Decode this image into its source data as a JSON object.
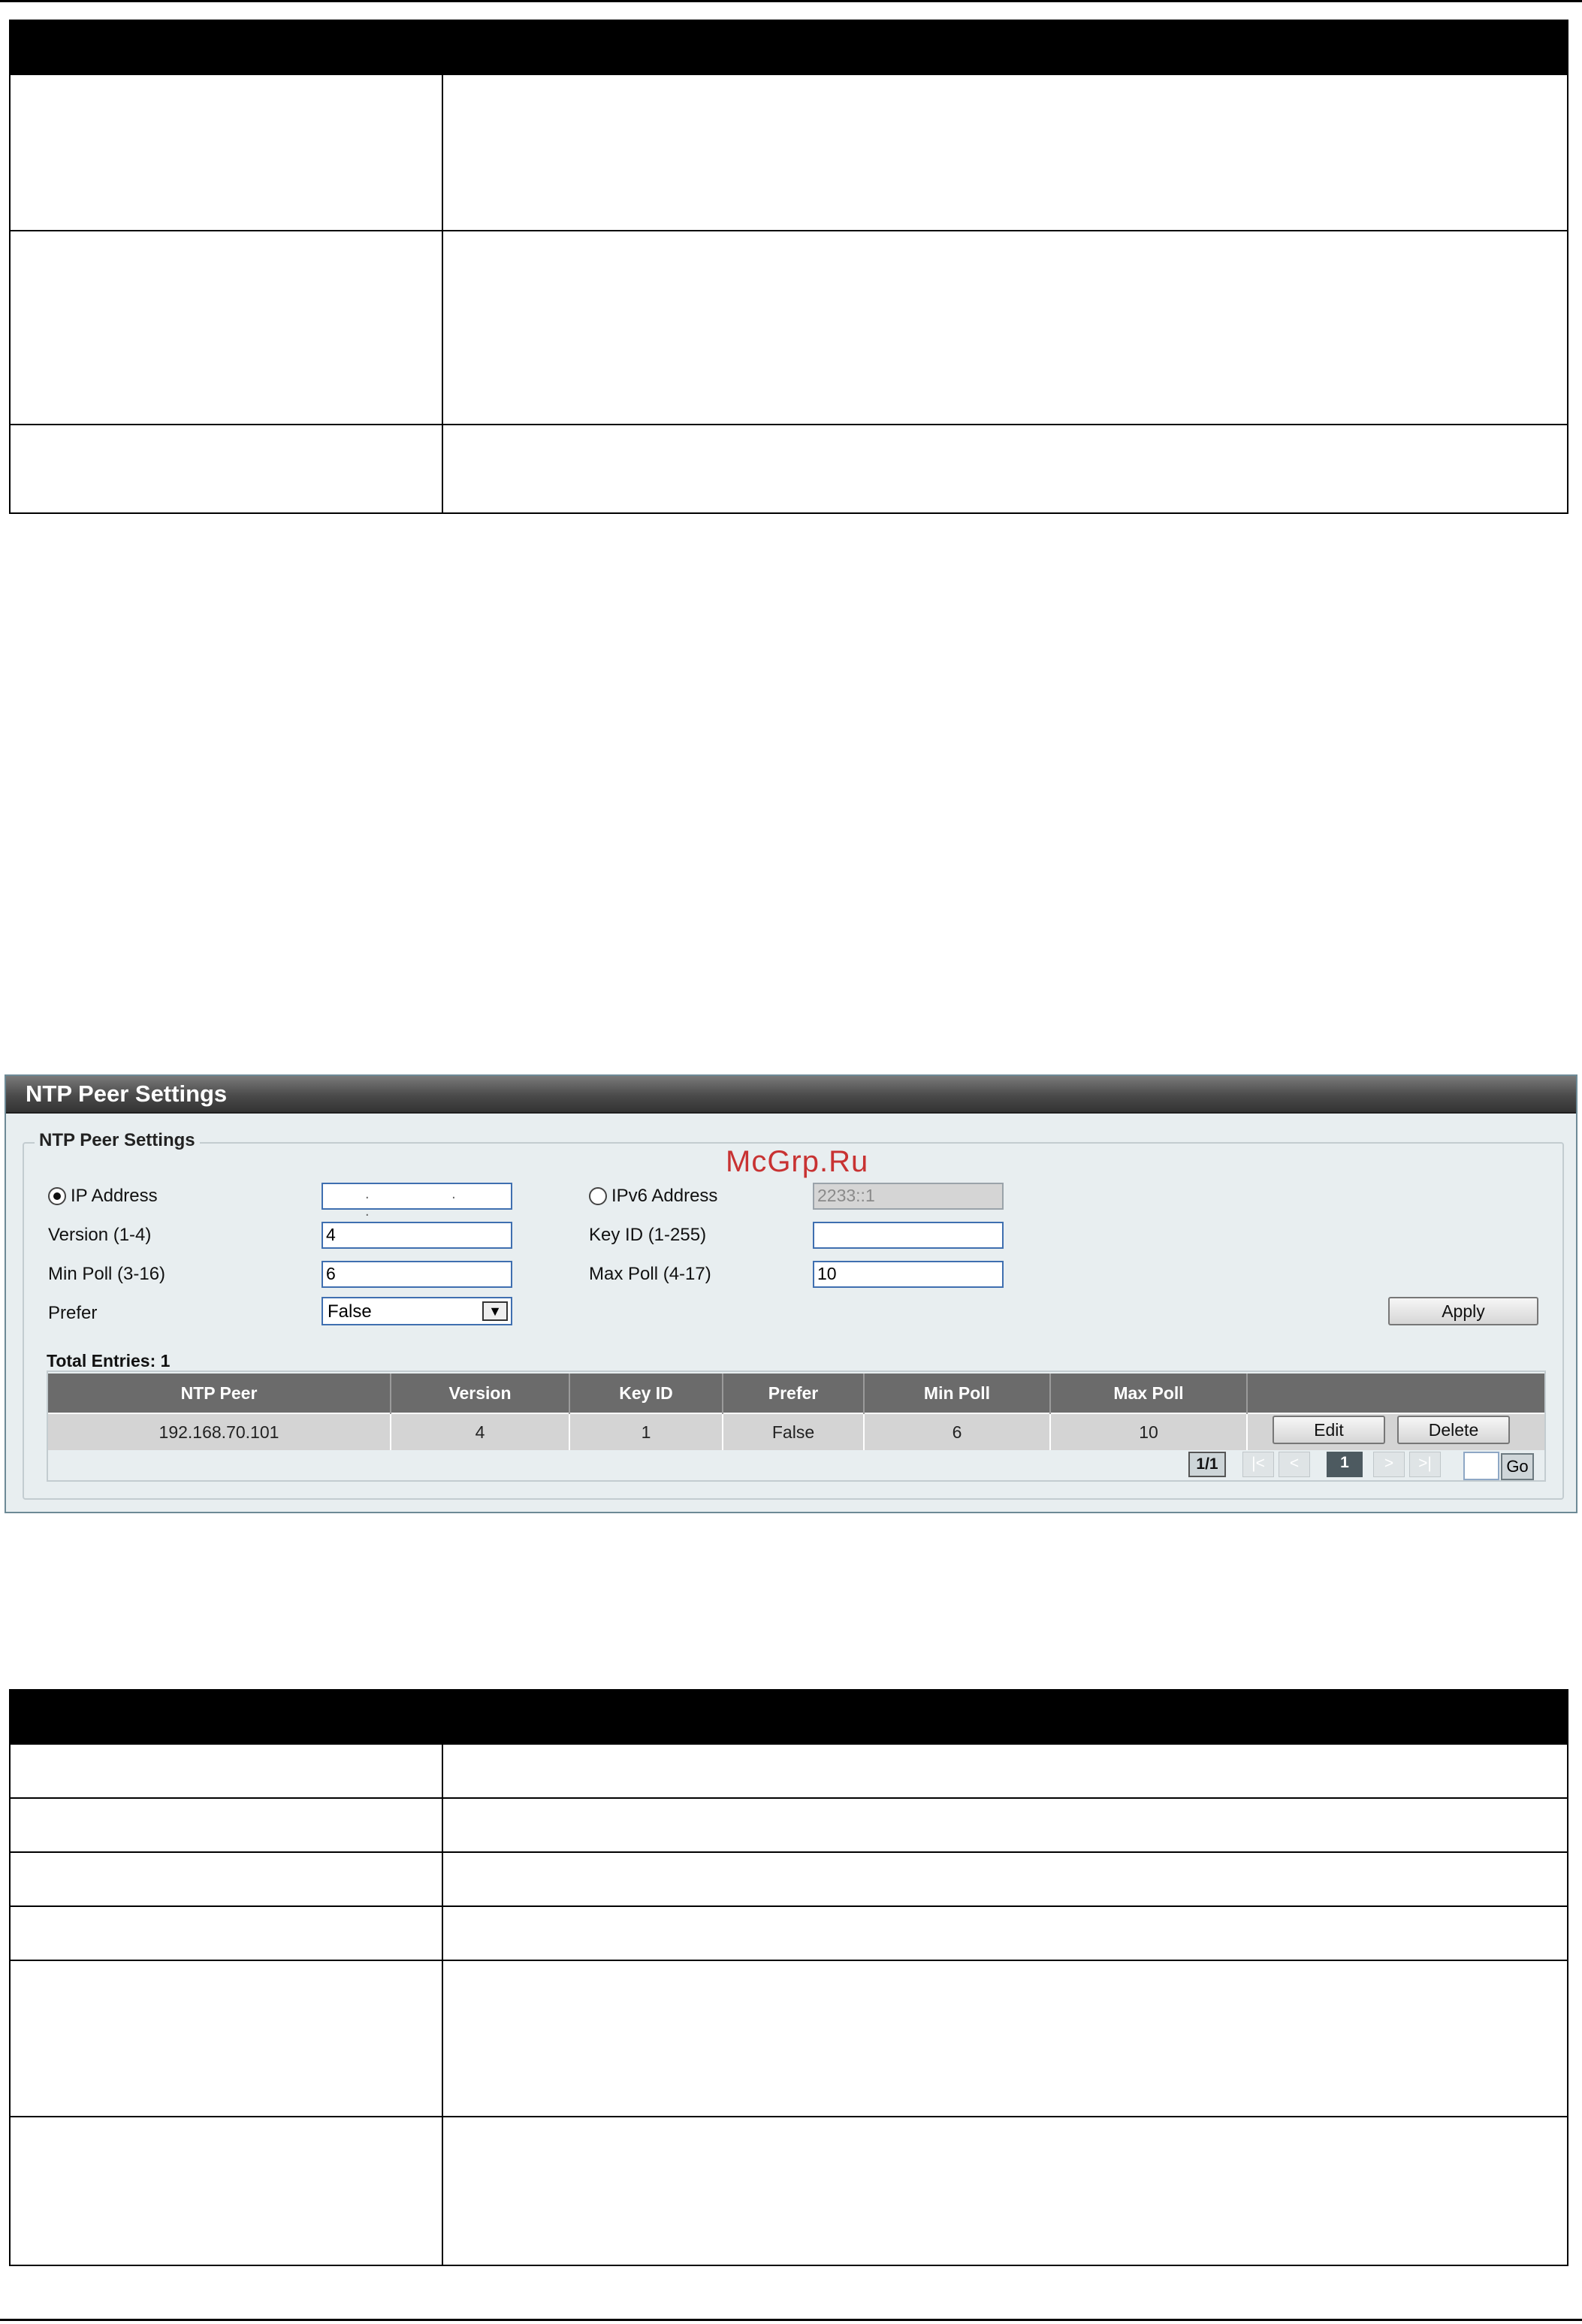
{
  "panel": {
    "title": "NTP Peer Settings",
    "legend": "NTP Peer Settings",
    "watermark": "McGrp.Ru"
  },
  "form": {
    "ip_address_label": "IP Address",
    "ip_address_value": ". . .",
    "ipv6_address_label": "IPv6 Address",
    "ipv6_address_value": "2233::1",
    "version_label": "Version (1-4)",
    "version_value": "4",
    "key_id_label": "Key ID (1-255)",
    "key_id_value": "",
    "min_poll_label": "Min Poll (3-16)",
    "min_poll_value": "6",
    "max_poll_label": "Max Poll (4-17)",
    "max_poll_value": "10",
    "prefer_label": "Prefer",
    "prefer_value": "False",
    "apply_label": "Apply",
    "ip_mode": "ip"
  },
  "table": {
    "total": "Total Entries: 1",
    "headers": [
      "NTP Peer",
      "Version",
      "Key ID",
      "Prefer",
      "Min Poll",
      "Max Poll",
      ""
    ],
    "rows": [
      {
        "peer": "192.168.70.101",
        "version": "4",
        "key_id": "1",
        "prefer": "False",
        "min_poll": "6",
        "max_poll": "10"
      }
    ],
    "edit_label": "Edit",
    "delete_label": "Delete"
  },
  "pager": {
    "info": "1/1",
    "first": "|<",
    "prev": "<",
    "current": "1",
    "next": ">",
    "last": ">|",
    "go_label": "Go"
  }
}
